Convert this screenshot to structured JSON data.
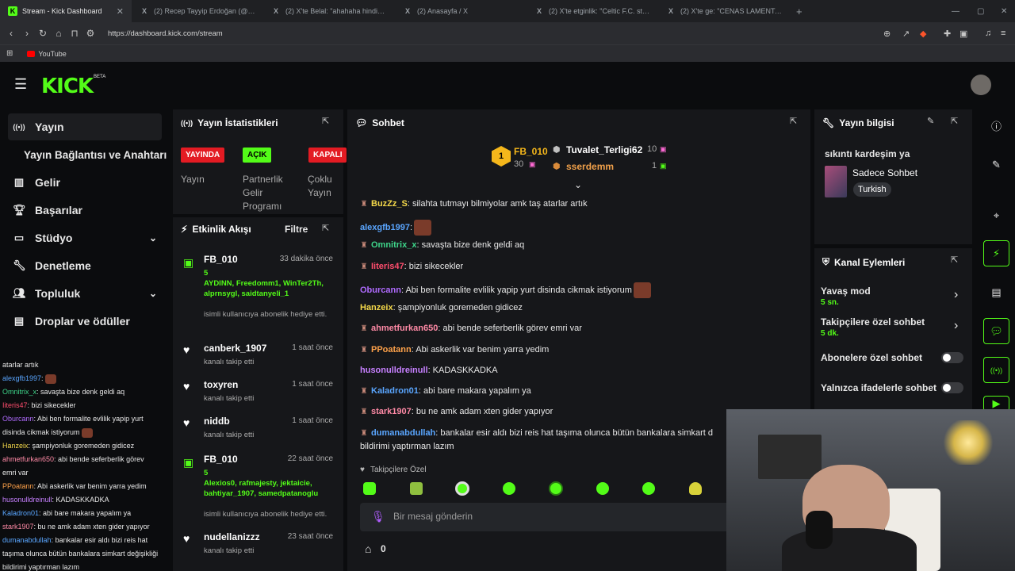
{
  "browser": {
    "tabs": [
      {
        "title": "Stream - Kick Dashboard",
        "fav": "K"
      },
      {
        "title": "(2) Recep Tayyip Erdoğan (@RTErdog",
        "fav": "X"
      },
      {
        "title": "(2) X'te Belal: \"ahahaha hindistanda o",
        "fav": "X"
      },
      {
        "title": "(2) Anasayfa / X",
        "fav": "X"
      },
      {
        "title": "(2) X'te etginlik: \"Celtic F.C. stadyumu",
        "fav": "X"
      },
      {
        "title": "(2) X'te ge: \"CENAS LAMENTAVEISI P",
        "fav": "X"
      }
    ],
    "url": "https://dashboard.kick.com/stream",
    "bookmark": "YouTube"
  },
  "header": {
    "logo": "KICK",
    "beta": "BETA"
  },
  "sidebar": {
    "items": [
      {
        "label": "Yayın",
        "icon": "broadcast-icon"
      },
      {
        "label": "Yayın Bağlantısı ve Anahtarı"
      },
      {
        "label": "Gelir",
        "icon": "chart-icon"
      },
      {
        "label": "Başarılar",
        "icon": "trophy-icon"
      },
      {
        "label": "Stüdyo",
        "icon": "studio-icon"
      },
      {
        "label": "Denetleme",
        "icon": "wrench-icon"
      },
      {
        "label": "Topluluk",
        "icon": "people-icon"
      },
      {
        "label": "Droplar ve ödüller",
        "icon": "drops-icon"
      }
    ]
  },
  "left_chat": [
    {
      "user": "",
      "text": "atarlar artık",
      "color": "#e8e8e8"
    },
    {
      "user": "alexgfb1997",
      "text": ":",
      "color": "#5aa6ff",
      "emote": true
    },
    {
      "user": "Omnitrix_x",
      "text": ": savaşta bize denk geldi aq",
      "color": "#3ed58a"
    },
    {
      "user": "Iiteris47",
      "text": ": bizi sikecekler",
      "color": "#ff4d6d"
    },
    {
      "user": "Oburcann",
      "text": ": Abi ben formalite evlilik yapip yurt",
      "color": "#b06bff"
    },
    {
      "user": "",
      "text": "disinda cikmak istiyorum",
      "color": "#e8e8e8",
      "emote": true
    },
    {
      "user": "Hanzeix",
      "text": ": şampiyonluk goremeden gidicez",
      "color": "#f5d94a"
    },
    {
      "user": "ahmetfurkan650",
      "text": ": abi bende seferberlik görev",
      "color": "#ff8aa6"
    },
    {
      "user": "",
      "text": "emri var",
      "color": "#e8e8e8"
    },
    {
      "user": "PPoatann",
      "text": ": Abi askerlik var benim yarra yedim",
      "color": "#ffa24a"
    },
    {
      "user": "husonulldreinull",
      "text": ": KADASKKADKA",
      "color": "#c780ff"
    },
    {
      "user": "Kaladron01",
      "text": ": abi bare makara yapalım ya",
      "color": "#5aa6ff"
    },
    {
      "user": "stark1907",
      "text": ": bu ne amk adam xten gider yapıyor",
      "color": "#ff8aa6"
    },
    {
      "user": "dumanabdullah",
      "text": ": bankalar esir aldı bizi reis hat",
      "color": "#5aa6ff"
    },
    {
      "user": "",
      "text": "taşıma olunca bütün bankalara simkart değişikliği",
      "color": "#e8e8e8"
    },
    {
      "user": "",
      "text": "bildirimi yaptırman lazım",
      "color": "#e8e8e8"
    }
  ],
  "stats": {
    "title": "Yayın İstatistikleri",
    "badges": [
      {
        "text": "YAYINDA",
        "label": "Yayın",
        "bg": "#e31b23"
      },
      {
        "text": "AÇIK",
        "label": "Partnerlik Gelir Programı",
        "bg": "#53fc18"
      },
      {
        "text": "KAPALI",
        "label": "Çoklu Yayın",
        "bg": "#e31b23"
      }
    ]
  },
  "activity": {
    "title": "Etkinlik Akışı",
    "filter": "Filtre",
    "items": [
      {
        "name": "FB_010",
        "time": "33 dakika önce",
        "type": "gift",
        "count": "5",
        "users": "AYDINN, Freedomm1, WinTer2Th, alprnsygl, saidtanyeli_1",
        "sub": "isimli kullanıcıya abonelik hediye etti."
      },
      {
        "name": "canberk_1907",
        "time": "1 saat önce",
        "type": "follow",
        "sub": "kanalı takip etti"
      },
      {
        "name": "toxyren",
        "time": "1 saat önce",
        "type": "follow",
        "sub": "kanalı takip etti"
      },
      {
        "name": "niddb",
        "time": "1 saat önce",
        "type": "follow",
        "sub": "kanalı takip etti"
      },
      {
        "name": "FB_010",
        "time": "22 saat önce",
        "type": "gift",
        "count": "5",
        "users": "Alexios0, rafmajesty, jektaicie, bahtiyar_1907, samedpatanoglu",
        "sub": "isimli kullanıcıya abonelik hediye etti."
      },
      {
        "name": "nudellanizzz",
        "time": "23 saat önce",
        "type": "follow",
        "sub": "kanalı takip etti"
      }
    ]
  },
  "chat": {
    "title": "Sohbet",
    "leaders": [
      {
        "name": "FB_010",
        "value": "30"
      },
      {
        "name": "Tuvalet_Terligi62",
        "value": "10"
      },
      {
        "name": "sserdemm",
        "value": "1"
      }
    ],
    "messages": [
      {
        "user": "BuzZz_S",
        "text": ": silahta tutmayı bilmiyolar amk taş atarlar artık",
        "color": "#f5d94a",
        "badge": true
      },
      {
        "user": "alexgfb1997",
        "text": ":",
        "color": "#5aa6ff",
        "emote": true
      },
      {
        "user": "Omnitrix_x",
        "text": ": savaşta bize denk geldi aq",
        "color": "#3ed58a",
        "badge": true
      },
      {
        "user": "Iiteris47",
        "text": ": bizi sikecekler",
        "color": "#ff4d6d",
        "badge": true
      },
      {
        "user": "Oburcann",
        "text": ": Abi ben formalite evlilik yapip yurt disinda cikmak istiyorum",
        "color": "#b06bff",
        "emote": true
      },
      {
        "user": "Hanzeix",
        "text": ": şampiyonluk goremeden gidicez",
        "color": "#f5d94a"
      },
      {
        "user": "ahmetfurkan650",
        "text": ": abi bende seferberlik görev emri var",
        "color": "#ff8aa6",
        "badge": true
      },
      {
        "user": "PPoatann",
        "text": ": Abi askerlik var benim yarra yedim",
        "color": "#ffa24a",
        "badge": true
      },
      {
        "user": "husonulldreinull",
        "text": ": KADASKKADKA",
        "color": "#c780ff"
      },
      {
        "user": "Kaladron01",
        "text": ": abi bare makara yapalım ya",
        "color": "#5aa6ff",
        "badge": true
      },
      {
        "user": "stark1907",
        "text": ": bu ne amk adam xten gider yapıyor",
        "color": "#ff8aa6",
        "badge": true
      },
      {
        "user": "dumanabdullah",
        "text": ": bankalar esir aldı bizi reis hat taşıma olunca bütün bankalara simkart d",
        "color": "#5aa6ff",
        "badge": true
      }
    ],
    "continuation": "bildirimi yaptırman lazım",
    "followers_label": "Takipçilere Özel",
    "input_placeholder": "Bir mesaj gönderin",
    "points": "0"
  },
  "info": {
    "title": "Yayın bilgisi",
    "stream_title": "sıkıntı kardeşim ya",
    "category": "Sadece Sohbet",
    "language": "Turkish"
  },
  "actions": {
    "title": "Kanal Eylemleri",
    "slow_mode": "Yavaş mod",
    "slow_value": "5 sn.",
    "followers_only": "Takipçilere özel sohbet",
    "followers_value": "5 dk.",
    "subs_only": "Abonelere özel sohbet",
    "emotes_only": "Yalnızca ifadelerle sohbet"
  }
}
